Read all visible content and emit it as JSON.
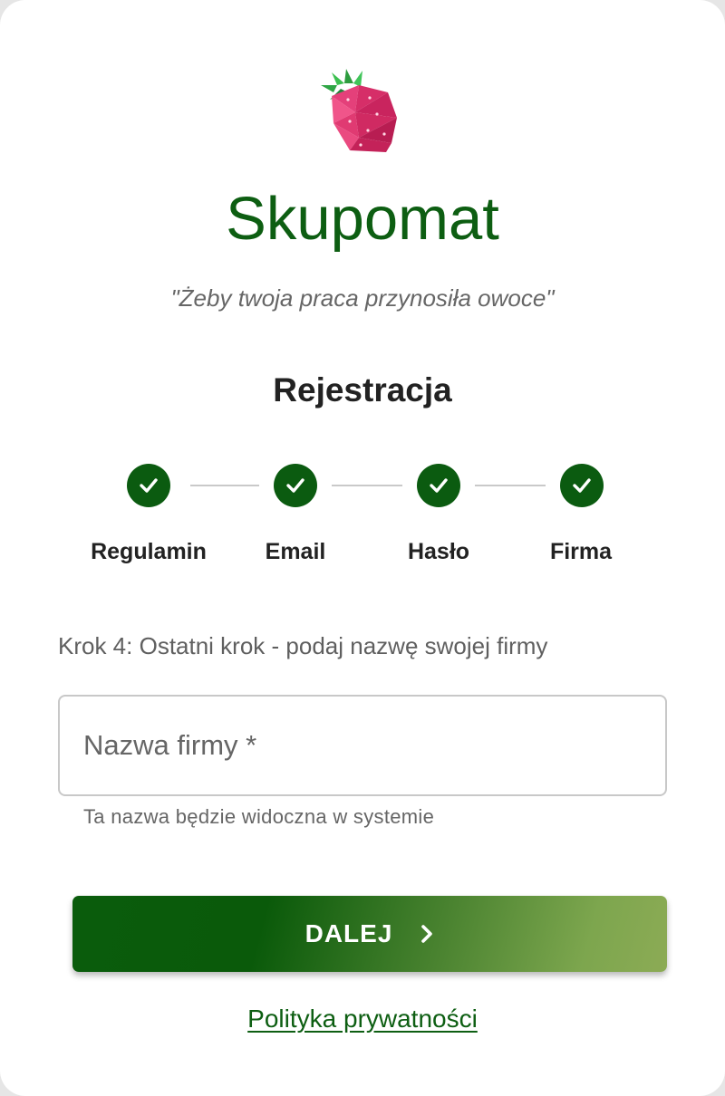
{
  "app": {
    "name": "Skupomat",
    "tagline": "\"Żeby twoja praca przynosiła owoce\"",
    "logo_icon": "strawberry-icon"
  },
  "page": {
    "heading": "Rejestracja"
  },
  "stepper": {
    "steps": [
      {
        "label": "Regulamin",
        "state": "completed"
      },
      {
        "label": "Email",
        "state": "completed"
      },
      {
        "label": "Hasło",
        "state": "completed"
      },
      {
        "label": "Firma",
        "state": "completed"
      }
    ],
    "check_icon": "check-icon"
  },
  "form": {
    "instruction": "Krok 4: Ostatni krok - podaj nazwę swojej firmy",
    "company_field": {
      "placeholder": "Nazwa firmy *",
      "value": "",
      "helper": "Ta nazwa będzie widoczna w systemie"
    },
    "next_button": {
      "label": "DALEJ",
      "icon": "chevron-right-icon"
    }
  },
  "footer": {
    "privacy_link": "Polityka prywatności"
  },
  "colors": {
    "primary": "#0b5b10",
    "accent_light": "#8cab55",
    "strawberry": "#e0306a"
  }
}
